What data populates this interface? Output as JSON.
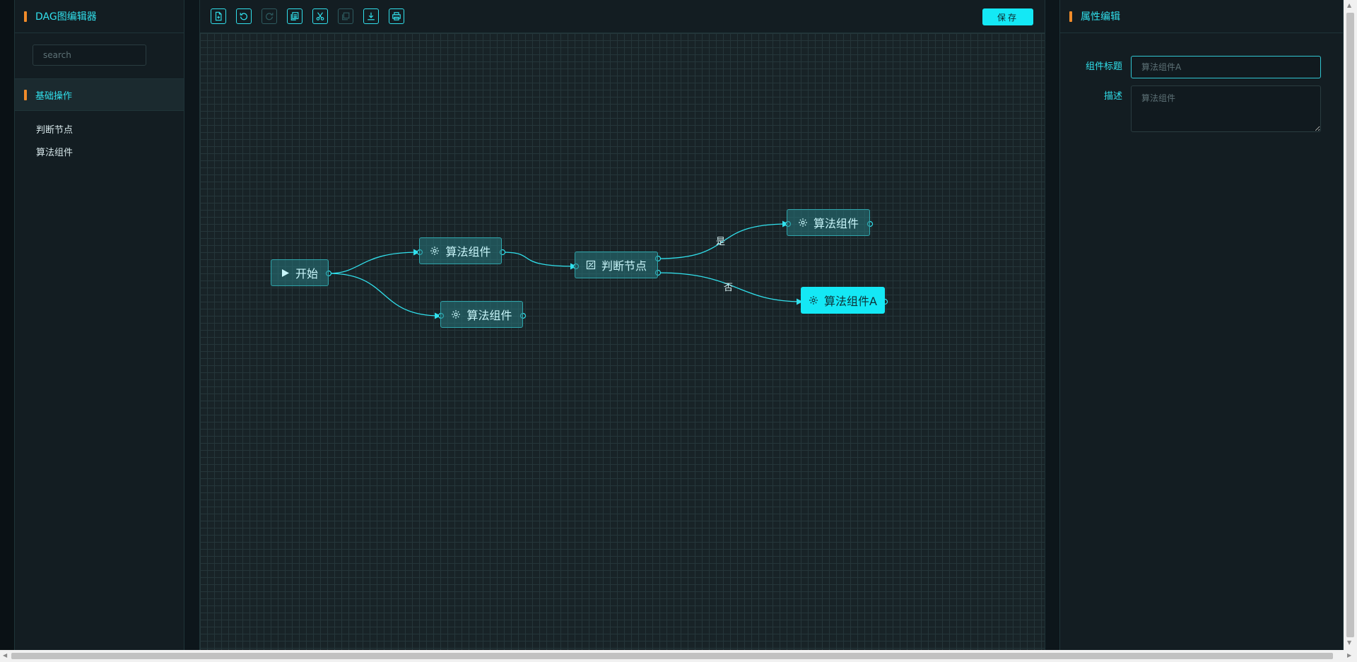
{
  "left_panel": {
    "title": "DAG图编辑器",
    "search": {
      "placeholder": "search",
      "value": ""
    },
    "section_title": "基础操作",
    "items": [
      {
        "label": "判断节点"
      },
      {
        "label": "算法组件"
      }
    ]
  },
  "toolbar": {
    "buttons": [
      {
        "icon": "new-file-icon",
        "enabled": true
      },
      {
        "icon": "undo-icon",
        "enabled": true
      },
      {
        "icon": "redo-icon",
        "enabled": false
      },
      {
        "icon": "copy-icon",
        "enabled": true
      },
      {
        "icon": "cut-icon",
        "enabled": true
      },
      {
        "icon": "paste-icon",
        "enabled": false
      },
      {
        "icon": "download-icon",
        "enabled": true
      },
      {
        "icon": "print-icon",
        "enabled": true
      }
    ],
    "save_label": "保存"
  },
  "graph": {
    "nodes": [
      {
        "id": "start",
        "label": "开始",
        "icon": "play-icon",
        "selected": false
      },
      {
        "id": "algo1",
        "label": "算法组件",
        "icon": "gear-icon",
        "selected": false
      },
      {
        "id": "algo2",
        "label": "算法组件",
        "icon": "gear-icon",
        "selected": false
      },
      {
        "id": "judge",
        "label": "判断节点",
        "icon": "decision-icon",
        "selected": false
      },
      {
        "id": "algo3",
        "label": "算法组件",
        "icon": "gear-icon",
        "selected": false
      },
      {
        "id": "algoA",
        "label": "算法组件A",
        "icon": "gear-icon",
        "selected": true
      }
    ],
    "edges": [
      {
        "from": "start",
        "to": "algo1",
        "label": ""
      },
      {
        "from": "start",
        "to": "algo2",
        "label": ""
      },
      {
        "from": "algo1",
        "to": "judge",
        "label": ""
      },
      {
        "from": "judge",
        "to": "algo3",
        "label": "是"
      },
      {
        "from": "judge",
        "to": "algoA",
        "label": "否"
      }
    ]
  },
  "right_panel": {
    "title": "属性编辑",
    "fields": {
      "title_label": "组件标题",
      "title_placeholder": "算法组件A",
      "title_value": "",
      "desc_label": "描述",
      "desc_placeholder": "算法组件",
      "desc_value": ""
    }
  },
  "colors": {
    "accent": "#31e0ec",
    "marker": "#f08b2a",
    "selected_node": "#14e8f5",
    "background": "#0d161b"
  }
}
